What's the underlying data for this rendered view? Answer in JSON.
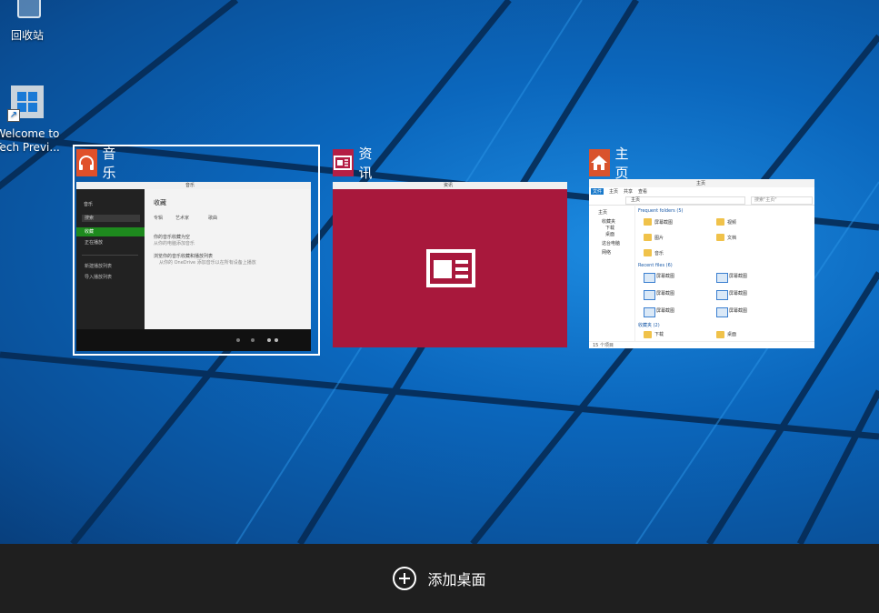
{
  "desktop": {
    "icons": [
      {
        "label": "回收站",
        "icon": "recycle-bin-icon"
      },
      {
        "label": "Welcome to Tech Previ...",
        "line1": "Welcome to",
        "line2": "Tech Previ...",
        "icon": "windows-logo-icon"
      }
    ]
  },
  "task_view": {
    "windows": [
      {
        "title": "音乐",
        "icon": "headphones-icon",
        "icon_color": "#e0502a",
        "selected": true,
        "thumb": {
          "window_title": "音乐",
          "sidebar_header": "音乐",
          "search": "搜索",
          "nav": [
            "收藏",
            "正在播放"
          ],
          "playlists": [
            "新建播放列表",
            "导入播放列表"
          ],
          "heading": "收藏",
          "filters": [
            "专辑",
            "艺术家",
            "歌曲"
          ],
          "notice1": "你的音乐收藏为空",
          "notice1_sub": "从你的电脑添加音乐",
          "notice2": "浏览你的音乐收藏和播放列表",
          "notice2_sub": "从你的 OneDrive 添加音乐以在所有设备上播放"
        }
      },
      {
        "title": "资讯",
        "icon": "news-icon",
        "icon_color": "#b51f45",
        "selected": false,
        "thumb": {
          "window_title": "资讯",
          "bg_color": "#a8183c"
        }
      },
      {
        "title": "主页",
        "icon": "home-icon",
        "icon_color": "#d9532c",
        "selected": false,
        "thumb": {
          "window_title": "主页",
          "ribbon_tabs": [
            "文件",
            "主页",
            "共享",
            "查看"
          ],
          "address": "主页",
          "search": "搜索\"主页\"",
          "nav": [
            "主页",
            "收藏夹",
            "下载",
            "桌面",
            "这台电脑",
            "网络"
          ],
          "frequent_header": "Frequent folders (5)",
          "frequent": [
            "屏幕截图",
            "视频",
            "图片",
            "文档",
            "音乐"
          ],
          "recent_header": "Recent files (6)",
          "recent": [
            "屏幕截图",
            "屏幕截图",
            "屏幕截图",
            "屏幕截图",
            "屏幕截图",
            "屏幕截图"
          ],
          "favorites_header": "收藏夹 (2)",
          "favorites": [
            "下载",
            "桌面"
          ],
          "status": "15 个项目"
        }
      }
    ]
  },
  "taskbar": {
    "add_desktop_label": "添加桌面",
    "add_icon": "plus-circle-icon"
  }
}
